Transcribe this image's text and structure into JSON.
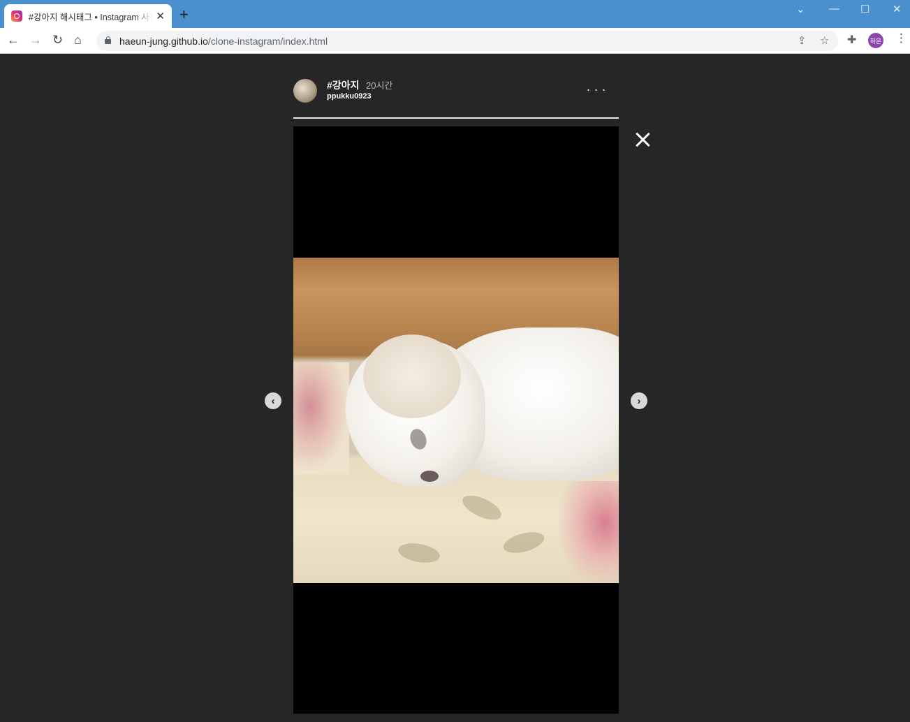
{
  "browser": {
    "tab_title": "#강아지 해시태그 • Instagram 사진 및 동영상",
    "tab_close": "✕",
    "new_tab": "+",
    "url_host": "haeun-jung.github.io",
    "url_path": "/clone-instagram/index.html",
    "profile_initials": "하은",
    "icons": {
      "back": "arrow-left-icon",
      "forward": "arrow-right-icon",
      "reload": "reload-icon",
      "home": "home-icon",
      "share": "share-icon",
      "bookmark": "star-icon",
      "extensions": "puzzle-icon",
      "menu": "kebab-menu-icon"
    }
  },
  "story": {
    "hashtag": "#강아지",
    "time": "20시간",
    "username": "ppukku0923",
    "more": "...",
    "prev": "‹",
    "next": "›"
  }
}
